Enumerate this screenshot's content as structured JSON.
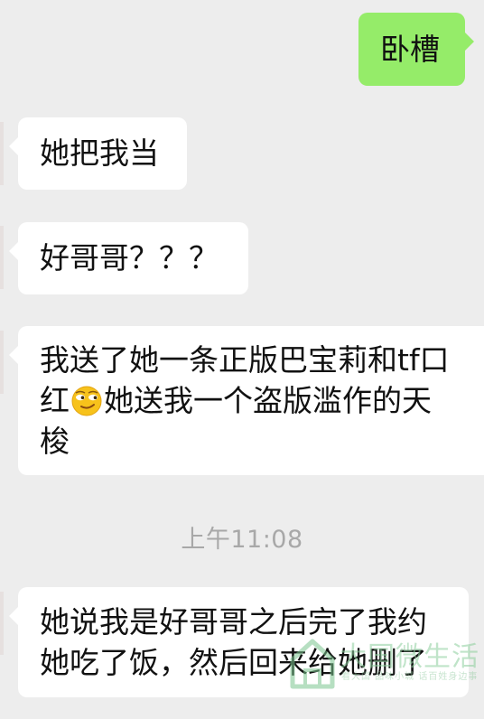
{
  "colors": {
    "background": "#ededed",
    "incoming_bubble": "#ffffff",
    "outgoing_bubble": "#95ec69",
    "timestamp_text": "#a8a8a8"
  },
  "messages": [
    {
      "direction": "outgoing",
      "text": "卧槽"
    },
    {
      "direction": "incoming",
      "text": "她把我当"
    },
    {
      "direction": "incoming",
      "text": "好哥哥？？？"
    },
    {
      "direction": "incoming",
      "line1": "我送了她一条正版巴宝莉和tf口",
      "line2_before_emoji": "红",
      "emoji": "smirk-emoji",
      "line2_after_emoji": "她送我一个盗版滥作的天",
      "line3": "梭"
    },
    {
      "direction": "incoming",
      "line1": "她说我是好哥哥之后完了我约",
      "line2": "她吃了饭，然后回来给她删了"
    }
  ],
  "timestamp": "上午11:08",
  "watermark": {
    "icon": "house-logo-icon",
    "text": "大国微生活",
    "subtext": "看大国 品味小城 话百姓身边事"
  }
}
